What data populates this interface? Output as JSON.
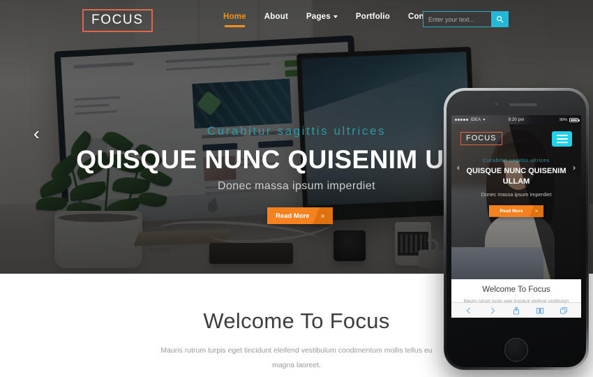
{
  "header": {
    "logo": "FOCUS",
    "nav": [
      {
        "label": "Home",
        "active": true,
        "caret": false
      },
      {
        "label": "About",
        "active": false,
        "caret": false
      },
      {
        "label": "Pages",
        "active": false,
        "caret": true
      },
      {
        "label": "Portfolio",
        "active": false,
        "caret": false
      },
      {
        "label": "Contact Us",
        "active": false,
        "caret": false
      }
    ],
    "search": {
      "placeholder": "Enter your text...",
      "value": "",
      "icon": "search-icon"
    }
  },
  "hero": {
    "prev_arrow": "‹",
    "next_arrow": "›",
    "subtitle": "Curabitur sagittis ultrices",
    "title": "QUISQUE NUNC QUISENIM ULLAM",
    "description": "Donec massa ipsum imperdiet",
    "button_label": "Read More",
    "button_arrow": "»"
  },
  "welcome": {
    "heading": "Welcome To Focus",
    "body": "Mauris rutrum turpis eget tincidunt eleifend vestibulum condimentum mollis tellus eu magna laoreet."
  },
  "phone": {
    "status_bar": {
      "carrier": "IDEA",
      "wifi_icon": "wifi-icon",
      "time": "9:20 pm",
      "battery_percent": "90%"
    },
    "logo": "FOCUS",
    "menu_icon": "hamburger-menu-icon",
    "prev_arrow": "‹",
    "next_arrow": "›",
    "subtitle": "Curabitur sagittis ultrices",
    "title": "QUISQUE NUNC QUISENIM ULLAM",
    "description": "Donec massa ipsum imperdiet",
    "button_label": "Read More",
    "button_arrow": "»",
    "welcome_heading": "Welcome To Focus",
    "welcome_body": "Mauris rutrum turpis eget tincidunt eleifend vestibulum condimentum mollis tellus eu magna laoreet.",
    "toolbar": [
      "back-icon",
      "forward-icon",
      "share-icon",
      "bookmarks-icon",
      "tabs-icon"
    ]
  },
  "colors": {
    "accent_orange": "#f5821f",
    "accent_orange_dark": "#e0720d",
    "accent_cyan": "#22b8d6",
    "phone_cyan": "#22d2ea",
    "logo_border": "#d9694a",
    "teal_text": "#2f97a8",
    "nav_active": "#f0931f",
    "heading_gray": "#3d3d3d",
    "body_gray": "#9a9a9a"
  },
  "background_scene": {
    "envato_watermark": "envato"
  }
}
